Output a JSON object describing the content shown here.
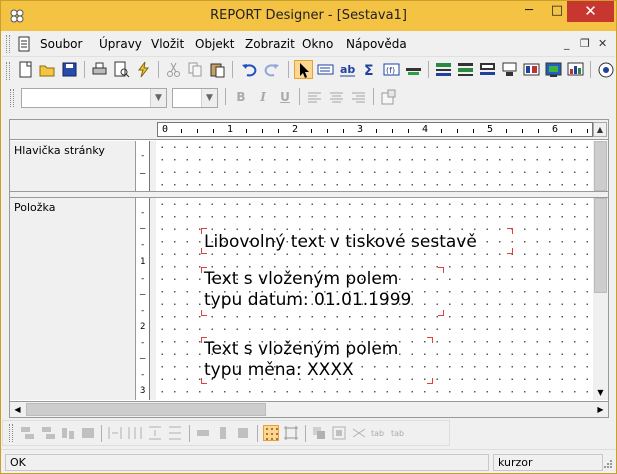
{
  "window": {
    "title": "REPORT Designer - [Sestava1]",
    "minimize": "─",
    "maximize": "□",
    "close": "✕"
  },
  "menu": {
    "items": [
      "Soubor",
      "Úpravy",
      "Vložit",
      "Objekt",
      "Zobrazit",
      "Okno",
      "Nápověda"
    ],
    "mdi_minimize": "_",
    "mdi_restore": "❐",
    "mdi_close": "✕"
  },
  "format_toolbar": {
    "font_value": "",
    "size_value": "",
    "bold": "B",
    "italic": "I",
    "underline": "U"
  },
  "ruler": {
    "numbers": [
      "0",
      "1",
      "2",
      "3",
      "4",
      "5",
      "6"
    ]
  },
  "bands": [
    {
      "label": "Hlavička stránky"
    },
    {
      "label": "Položka"
    }
  ],
  "vruler_marks": [
    "1",
    "2",
    "3"
  ],
  "report_items": [
    {
      "text": "Libovolný text v tiskové sestavě"
    },
    {
      "text": "Text s vloženým polem\ntypu datum: 01.01.1999"
    },
    {
      "text": "Text s vloženým polem\ntypu měna: XXXX"
    }
  ],
  "status": {
    "message": "OK",
    "mode": "kurzor"
  },
  "colors": {
    "titlebar": "#f5c343",
    "close": "#c7372f",
    "selection": "#fcd791",
    "handles": "#e04040"
  }
}
